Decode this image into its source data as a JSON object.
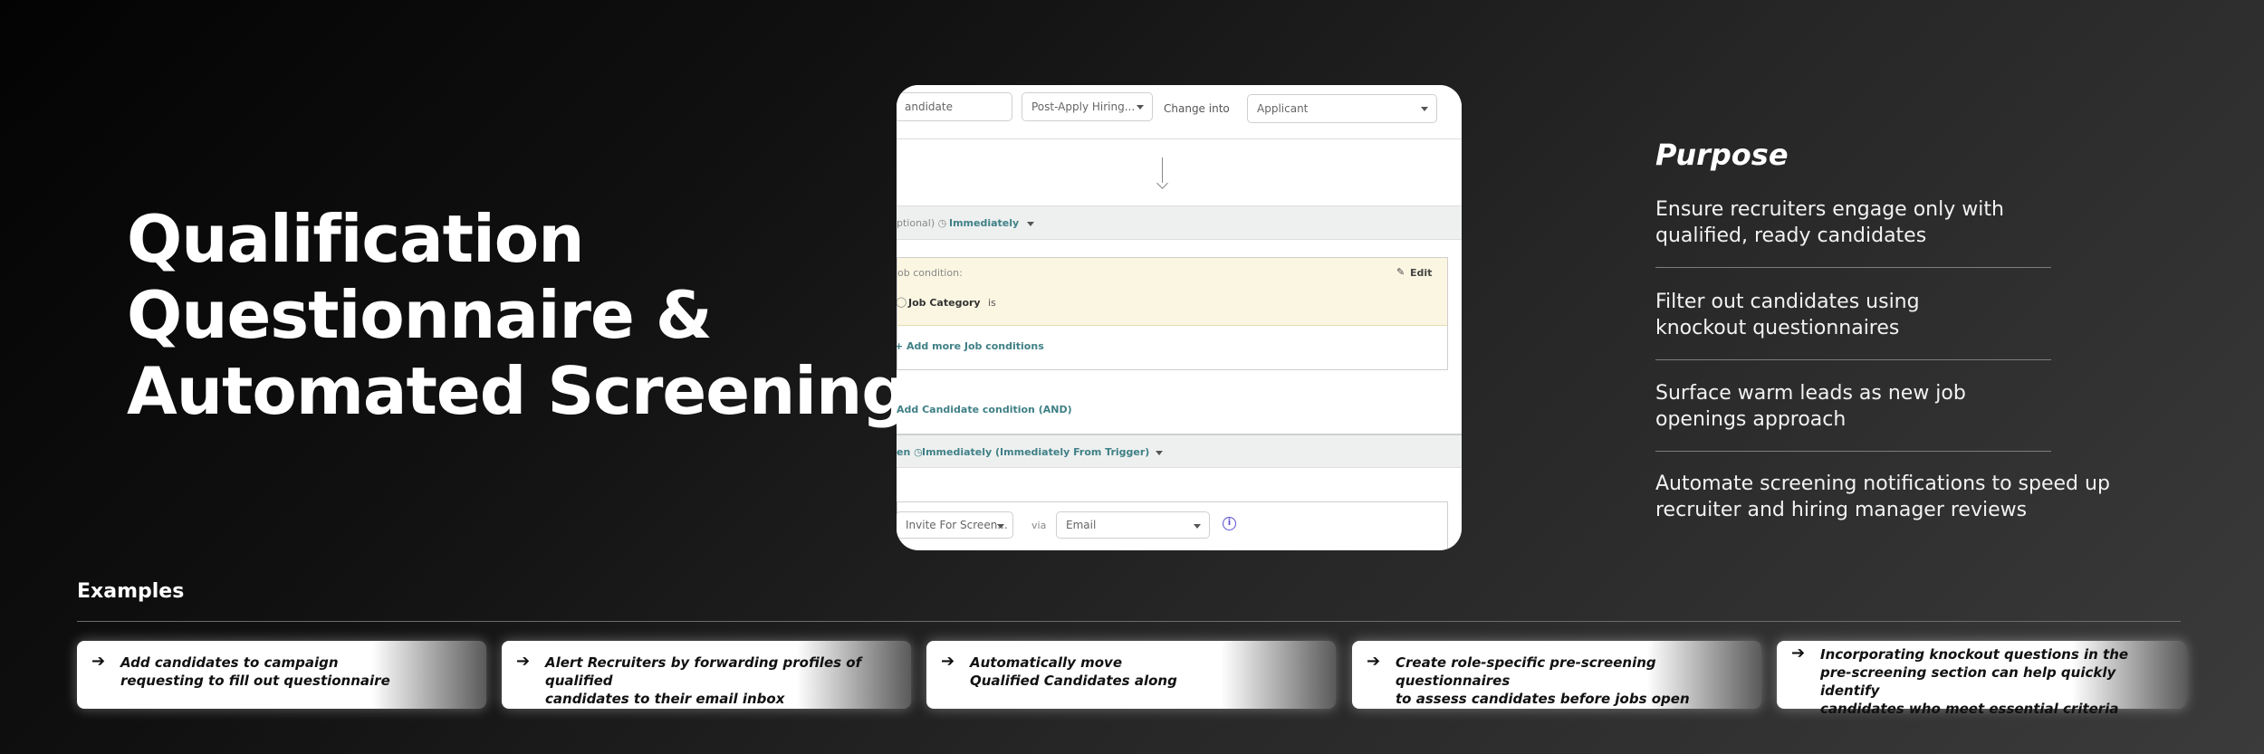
{
  "title": {
    "line1": "Qualification",
    "line2": "Questionnaire &",
    "line3": "Automated Screening"
  },
  "screenshot": {
    "field1_value": "andidate",
    "field2_value": "Post-Apply Hiring...",
    "change_into_label": "Change into",
    "field3_value": "Applicant",
    "section1_prefix": "ptional) ◷",
    "section1_value": "Immediately",
    "condition_label": "ob  condition:",
    "edit_label": "Edit",
    "job_category_label": "Job Category",
    "job_category_op": "is",
    "add_more_job_conditions": "+ Add more Job conditions",
    "add_candidate_condition": "Add Candidate condition (AND)",
    "section2_prefix": "en ◷",
    "section2_value": "Immediately (Immediately From Trigger)",
    "action_value": "Invite For Screen...",
    "via_label": "via",
    "channel_value": "Email"
  },
  "purpose": {
    "heading": "Purpose",
    "items": [
      "Ensure recruiters engage only with\nqualified, ready candidates",
      "Filter out candidates using\nknockout questionnaires",
      "Surface warm leads as new job\nopenings approach",
      "Automate screening notifications to speed up\nrecruiter and hiring manager reviews"
    ]
  },
  "examples": {
    "heading": "Examples",
    "arrow": "➔",
    "cards": [
      "Add candidates to campaign\nrequesting to fill out questionnaire",
      "Alert Recruiters by forwarding profiles of qualified\ncandidates to their email inbox",
      "Automatically move\nQualified Candidates along",
      "Create role-specific pre-screening questionnaires\nto assess candidates before jobs open",
      "Incorporating knockout questions in the\npre-screening section can help quickly identify\ncandidates who meet essential criteria"
    ]
  }
}
